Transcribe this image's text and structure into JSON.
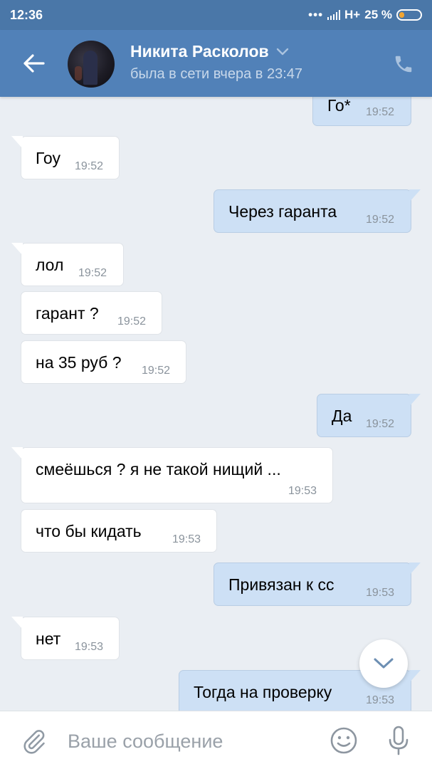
{
  "status_bar": {
    "time": "12:36",
    "network": "H+",
    "battery_pct": "25 %",
    "battery_level": 0.25
  },
  "header": {
    "contact_name": "Никита Расколов",
    "last_seen": "была в сети вчера в 23:47"
  },
  "messages": [
    {
      "dir": "out",
      "text": "Го*",
      "time": "19:52"
    },
    {
      "dir": "in",
      "text": "Гоу",
      "time": "19:52"
    },
    {
      "dir": "out",
      "text": "Через гаранта",
      "time": "19:52"
    },
    {
      "dir": "in",
      "text": "лол",
      "time": "19:52"
    },
    {
      "dir": "in",
      "text": "гарант ?",
      "time": "19:52"
    },
    {
      "dir": "in",
      "text": "на 35 руб ?",
      "time": "19:52"
    },
    {
      "dir": "out",
      "text": "Да",
      "time": "19:52"
    },
    {
      "dir": "in",
      "text": "смеёшься ? я не такой нищий ...",
      "time": "19:53"
    },
    {
      "dir": "in",
      "text": "что бы кидать",
      "time": "19:53"
    },
    {
      "dir": "out",
      "text": "Привязан к сс",
      "time": "19:53"
    },
    {
      "dir": "in",
      "text": "нет",
      "time": "19:53"
    },
    {
      "dir": "out",
      "text": "Тогда на проверку",
      "time": "19:53"
    }
  ],
  "composer": {
    "placeholder": "Ваше сообщение"
  },
  "icons": {
    "back": "arrow-left-icon",
    "call": "phone-icon",
    "dropdown": "chevron-down-icon",
    "attach": "paperclip-icon",
    "emoji": "smiley-icon",
    "mic": "microphone-icon",
    "scroll_down": "chevron-down-icon"
  },
  "colors": {
    "header": "#5181b8",
    "status_bar": "#4a77a8",
    "background": "#eaeef3",
    "incoming_bubble": "#ffffff",
    "outgoing_bubble": "#cde0f5",
    "battery_fill": "#f2a531"
  }
}
